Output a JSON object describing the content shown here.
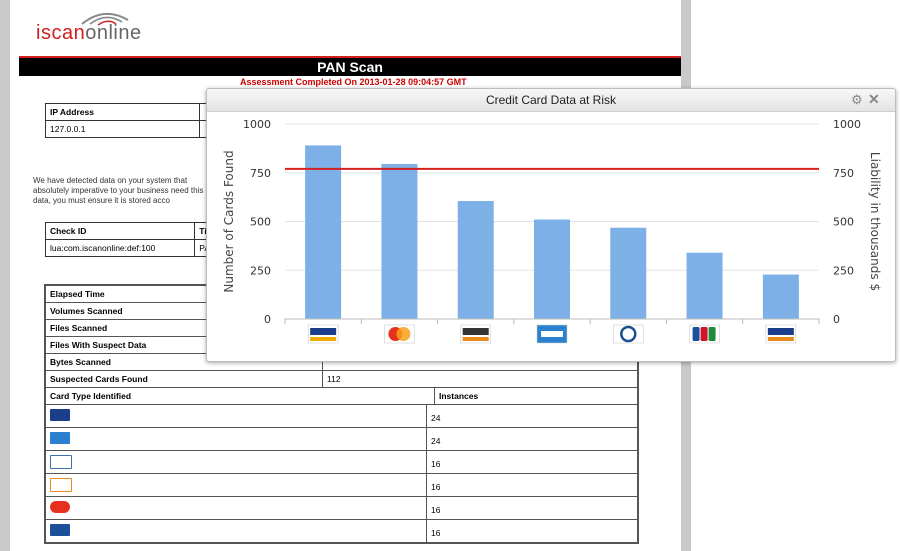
{
  "logo": {
    "text_part1": "iscan",
    "text_part2": "online"
  },
  "report": {
    "title": "PAN Scan",
    "assessment_line": "Assessment Completed On 2013-01-28 09:04:57 GMT",
    "ip_table": {
      "header": "IP Address",
      "value": "127.0.0.1"
    },
    "paragraph": "We have detected data on your system that absolutely imperative to your business need this data, you must ensure it is stored acco",
    "check_table": {
      "header1": "Check ID",
      "header2": "Tit",
      "value1": "lua:com.iscanonline:def:100",
      "value2": "PA"
    },
    "stats": [
      {
        "label": "Elapsed Time",
        "value": ""
      },
      {
        "label": "Volumes Scanned",
        "value": ""
      },
      {
        "label": "Files Scanned",
        "value": ""
      },
      {
        "label": "Files With Suspect Data",
        "value": ""
      },
      {
        "label": "Bytes Scanned",
        "value": ""
      },
      {
        "label": "Suspected Cards Found",
        "value": "112"
      }
    ],
    "card_header": {
      "type": "Card Type Identified",
      "instances": "Instances"
    },
    "cards": [
      {
        "icon": "visa-icon",
        "instances": "24",
        "color": "#1a3e8c"
      },
      {
        "icon": "amex-icon",
        "instances": "24",
        "color": "#2b7fcf"
      },
      {
        "icon": "diners-icon",
        "instances": "16",
        "color": "#3a6fb0"
      },
      {
        "icon": "discover-icon",
        "instances": "16",
        "color": "#e98a1e"
      },
      {
        "icon": "mastercard-icon",
        "instances": "16",
        "color": "#e8301e"
      },
      {
        "icon": "jcb-icon",
        "instances": "16",
        "color": "#1b4f9a"
      }
    ]
  },
  "popup": {
    "title": "Credit Card Data at Risk",
    "gear_icon": "gear-icon",
    "close_icon": "close-icon"
  },
  "chart_data": {
    "type": "bar",
    "title": "Credit Card Data at Risk",
    "ylabel": "Number of Cards Found",
    "y2label": "Liability in thousands $",
    "ylim": [
      0,
      1000
    ],
    "y2lim": [
      0,
      1000
    ],
    "yticks": [
      0,
      250,
      500,
      750,
      1000
    ],
    "categories": [
      "visa-icon",
      "mastercard-icon",
      "discover-icon",
      "amex-icon",
      "diners-icon",
      "jcb-icon",
      "visa-electron-icon"
    ],
    "values": [
      890,
      795,
      605,
      510,
      468,
      340,
      228
    ],
    "threshold_line": 770,
    "bar_color": "#7cb0e6",
    "line_color": "#d42020",
    "grid": true
  }
}
